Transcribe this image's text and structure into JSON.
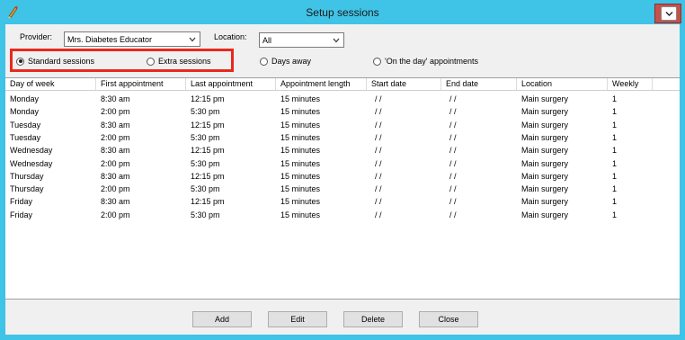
{
  "window": {
    "title": "Setup sessions",
    "icon": "pencil-icon"
  },
  "filters": {
    "provider_label": "Provider:",
    "provider_value": "Mrs. Diabetes Educator",
    "location_label": "Location:",
    "location_value": "All"
  },
  "session_types": {
    "standard": "Standard sessions",
    "extra": "Extra sessions",
    "days_away": "Days away",
    "on_the_day": "'On the day' appointments",
    "selected": "standard"
  },
  "table": {
    "columns": [
      "Day of week",
      "First appointment",
      "Last appointment",
      "Appointment length",
      "Start date",
      "End date",
      "Location",
      "Weekly"
    ],
    "rows": [
      [
        "Monday",
        "8:30 am",
        "12:15 pm",
        "15 minutes",
        "/ /",
        "/ /",
        "Main surgery",
        "1"
      ],
      [
        "Monday",
        "2:00 pm",
        "5:30 pm",
        "15 minutes",
        "/ /",
        "/ /",
        "Main surgery",
        "1"
      ],
      [
        "Tuesday",
        "8:30 am",
        "12:15 pm",
        "15 minutes",
        "/ /",
        "/ /",
        "Main surgery",
        "1"
      ],
      [
        "Tuesday",
        "2:00 pm",
        "5:30 pm",
        "15 minutes",
        "/ /",
        "/ /",
        "Main surgery",
        "1"
      ],
      [
        "Wednesday",
        "8:30 am",
        "12:15 pm",
        "15 minutes",
        "/ /",
        "/ /",
        "Main surgery",
        "1"
      ],
      [
        "Wednesday",
        "2:00 pm",
        "5:30 pm",
        "15 minutes",
        "/ /",
        "/ /",
        "Main surgery",
        "1"
      ],
      [
        "Thursday",
        "8:30 am",
        "12:15 pm",
        "15 minutes",
        "/ /",
        "/ /",
        "Main surgery",
        "1"
      ],
      [
        "Thursday",
        "2:00 pm",
        "5:30 pm",
        "15 minutes",
        "/ /",
        "/ /",
        "Main surgery",
        "1"
      ],
      [
        "Friday",
        "8:30 am",
        "12:15 pm",
        "15 minutes",
        "/ /",
        "/ /",
        "Main surgery",
        "1"
      ],
      [
        "Friday",
        "2:00 pm",
        "5:30 pm",
        "15 minutes",
        "/ /",
        "/ /",
        "Main surgery",
        "1"
      ]
    ]
  },
  "buttons": {
    "add": "Add",
    "edit": "Edit",
    "delete": "Delete",
    "close": "Close"
  },
  "colors": {
    "titlebar": "#3fc3e6",
    "highlight": "#e8291c",
    "close_button": "#c7504a"
  }
}
